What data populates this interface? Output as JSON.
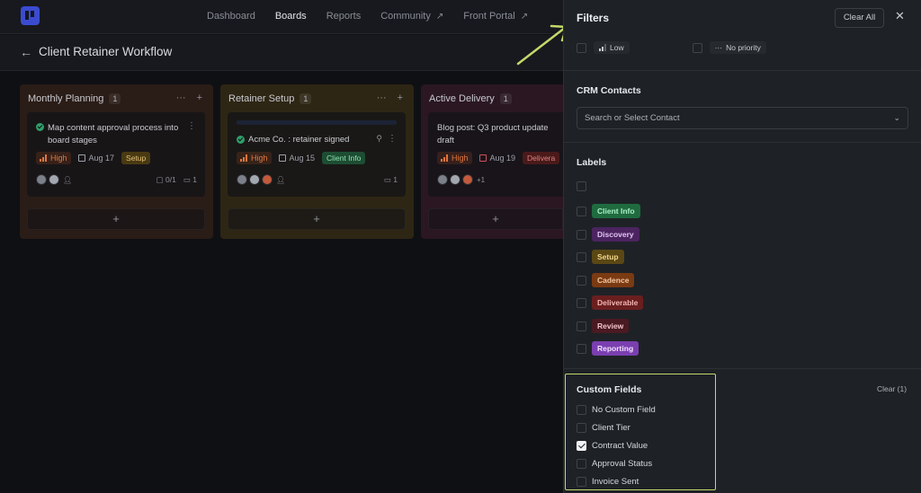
{
  "nav": {
    "links": [
      {
        "label": "Dashboard",
        "arrow": ""
      },
      {
        "label": "Boards",
        "arrow": ""
      },
      {
        "label": "Reports",
        "arrow": ""
      },
      {
        "label": "Community",
        "arrow": "↗"
      },
      {
        "label": "Front Portal",
        "arrow": "↗"
      }
    ]
  },
  "board": {
    "back_icon": "←",
    "title": "Client Retainer Workflow"
  },
  "columns": [
    {
      "name": "Monthly Planning",
      "count": "1",
      "more": "···",
      "add": "+",
      "color": "#2a1c16",
      "card": {
        "title": "Map content approval process into board stages",
        "priority": "High",
        "date": "Aug 17",
        "tag": "Setup",
        "checklist": "0/1",
        "comments": "1"
      }
    },
    {
      "name": "Retainer Setup",
      "count": "1",
      "more": "···",
      "add": "+",
      "color": "#2e2614",
      "card": {
        "title": "Acme Co. : retainer signed",
        "priority": "High",
        "date": "Aug 15",
        "tag": "Client Info",
        "comments": "1"
      }
    },
    {
      "name": "Active Delivery",
      "count": "1",
      "more": "",
      "color": "#2a1722",
      "card": {
        "title": "Blog post: Q3 product update draft",
        "priority": "High",
        "date": "Aug 19",
        "tag": "Delivera",
        "extra_assignees": "+1"
      }
    }
  ],
  "add_card_label": "+",
  "filters": {
    "title": "Filters",
    "clear_all": "Clear All",
    "close": "✕",
    "priority": {
      "low": "Low",
      "none": "No priority",
      "none_icon": "···"
    },
    "crm": {
      "title": "CRM Contacts",
      "placeholder": "Search or Select Contact"
    },
    "labels": {
      "title": "Labels",
      "items": [
        {
          "name": "Client Info",
          "bg": "#1f6b3f",
          "fg": "#a8f0c4"
        },
        {
          "name": "Discovery",
          "bg": "#4b2460",
          "fg": "#e2c4f2"
        },
        {
          "name": "Setup",
          "bg": "#5a4714",
          "fg": "#f1d58a"
        },
        {
          "name": "Cadence",
          "bg": "#7a3a12",
          "fg": "#f6c8a2"
        },
        {
          "name": "Deliverable",
          "bg": "#6a1f1f",
          "fg": "#f3b4b4"
        },
        {
          "name": "Review",
          "bg": "#4a1a22",
          "fg": "#f0c2c8"
        },
        {
          "name": "Reporting",
          "bg": "#7b3fb0",
          "fg": "#f1e2ff"
        }
      ]
    },
    "custom_fields": {
      "title": "Custom Fields",
      "clear": "Clear (1)",
      "items": [
        {
          "name": "No Custom Field",
          "checked": false
        },
        {
          "name": "Client Tier",
          "checked": false
        },
        {
          "name": "Contract Value",
          "checked": true
        },
        {
          "name": "Approval Status",
          "checked": false
        },
        {
          "name": "Invoice Sent",
          "checked": false
        }
      ]
    }
  },
  "colors": {
    "highlight": "#c4d86a",
    "accent": "#3b4bd0"
  }
}
